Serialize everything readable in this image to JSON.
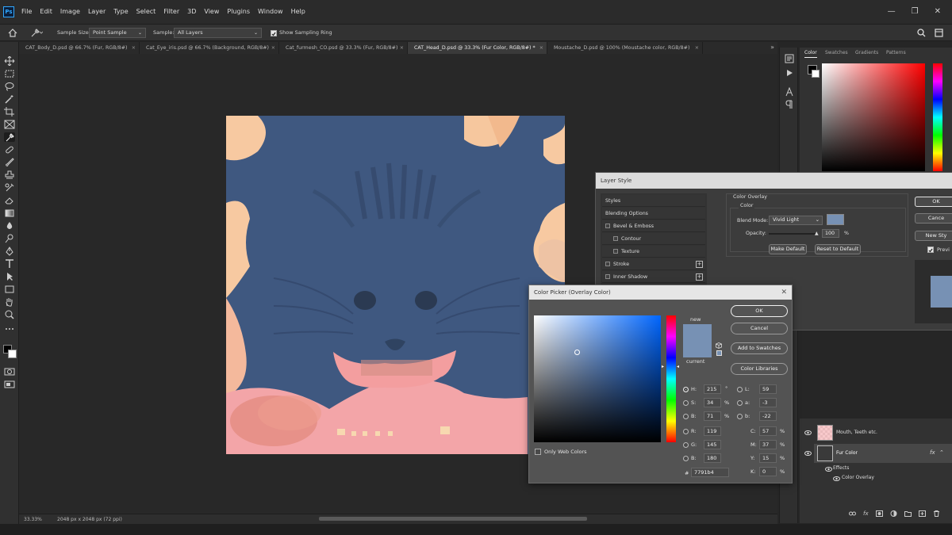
{
  "menu": {
    "logo": "Ps",
    "items": [
      "File",
      "Edit",
      "Image",
      "Layer",
      "Type",
      "Select",
      "Filter",
      "3D",
      "View",
      "Plugins",
      "Window",
      "Help"
    ],
    "window_controls": [
      "—",
      "❐",
      "✕"
    ]
  },
  "options": {
    "sample_size_label": "Sample Size:",
    "sample_size_value": "Point Sample",
    "sample_label": "Sample:",
    "sample_value": "All Layers",
    "sampling_ring_label": "Show Sampling Ring"
  },
  "tabs": [
    {
      "label": "CAT_Body_D.psd @ 66.7% (Fur, RGB/8#)"
    },
    {
      "label": "Cat_Eye_iris.psd @ 66.7% (Background, RGB/8#)"
    },
    {
      "label": "Cat_furmesh_CO.psd @ 33.3% (Fur, RGB/8#)"
    },
    {
      "label": "CAT_Head_D.psd @ 33.3% (Fur Color, RGB/8#) *"
    },
    {
      "label": "Moustache_D.psd @ 100% (Moustache color, RGB/8#)"
    }
  ],
  "status": {
    "zoom": "33.33%",
    "doc_info": "2048 px x 2048 px (72 ppi)"
  },
  "color_panel": {
    "tabs": [
      "Color",
      "Swatches",
      "Gradients",
      "Patterns"
    ]
  },
  "layer_style": {
    "title": "Layer Style",
    "items": [
      {
        "label": "Styles",
        "check": false,
        "plus": false,
        "indent": false
      },
      {
        "label": "Blending Options",
        "check": false,
        "plus": false,
        "indent": false
      },
      {
        "label": "Bevel & Emboss",
        "check": true,
        "plus": false,
        "indent": false
      },
      {
        "label": "Contour",
        "check": true,
        "plus": false,
        "indent": true
      },
      {
        "label": "Texture",
        "check": true,
        "plus": false,
        "indent": true
      },
      {
        "label": "Stroke",
        "check": true,
        "plus": true,
        "indent": false
      },
      {
        "label": "Inner Shadow",
        "check": true,
        "plus": true,
        "indent": false
      }
    ],
    "section_title": "Color Overlay",
    "sub_title": "Color",
    "blend_mode_label": "Blend Mode:",
    "blend_mode_value": "Vivid Light",
    "opacity_label": "Opacity:",
    "opacity_value": "100",
    "opacity_unit": "%",
    "make_default": "Make Default",
    "reset_default": "Reset to Default",
    "ok": "OK",
    "cancel": "Cance",
    "new_style": "New Sty",
    "preview": "Previ",
    "overlay_color": "#7791b4"
  },
  "color_picker": {
    "title": "Color Picker (Overlay Color)",
    "new_label": "new",
    "current_label": "current",
    "ok": "OK",
    "cancel": "Cancel",
    "add_to_swatches": "Add to Swatches",
    "color_libraries": "Color Libraries",
    "only_web_colors": "Only Web Colors",
    "fields": {
      "H": {
        "label": "H:",
        "value": "215",
        "unit": "°"
      },
      "S": {
        "label": "S:",
        "value": "34",
        "unit": "%"
      },
      "B": {
        "label": "B:",
        "value": "71",
        "unit": "%"
      },
      "R": {
        "label": "R:",
        "value": "119",
        "unit": ""
      },
      "G": {
        "label": "G:",
        "value": "145",
        "unit": ""
      },
      "Bl": {
        "label": "B:",
        "value": "180",
        "unit": ""
      },
      "L": {
        "label": "L:",
        "value": "59",
        "unit": ""
      },
      "a": {
        "label": "a:",
        "value": "-3",
        "unit": ""
      },
      "b": {
        "label": "b:",
        "value": "-22",
        "unit": ""
      },
      "C": {
        "label": "C:",
        "value": "57",
        "unit": "%"
      },
      "M": {
        "label": "M:",
        "value": "37",
        "unit": "%"
      },
      "Y": {
        "label": "Y:",
        "value": "15",
        "unit": "%"
      },
      "K": {
        "label": "K:",
        "value": "0",
        "unit": "%"
      }
    },
    "hex_label": "#",
    "hex_value": "7791b4",
    "new_color": "#7791b4",
    "current_color": "#7791b4",
    "hue_color": "#0066ff"
  },
  "layers": [
    {
      "name": "Mouth, Teeth etc."
    },
    {
      "name": "Fur Color",
      "fx": "fx"
    }
  ],
  "effects": {
    "label": "Effects",
    "item": "Color Overlay"
  },
  "colors": {
    "fur_blue": "#3f5880",
    "pink": "#f3a5a8",
    "peach": "#f7c9a1",
    "accent": "#31a8ff"
  }
}
